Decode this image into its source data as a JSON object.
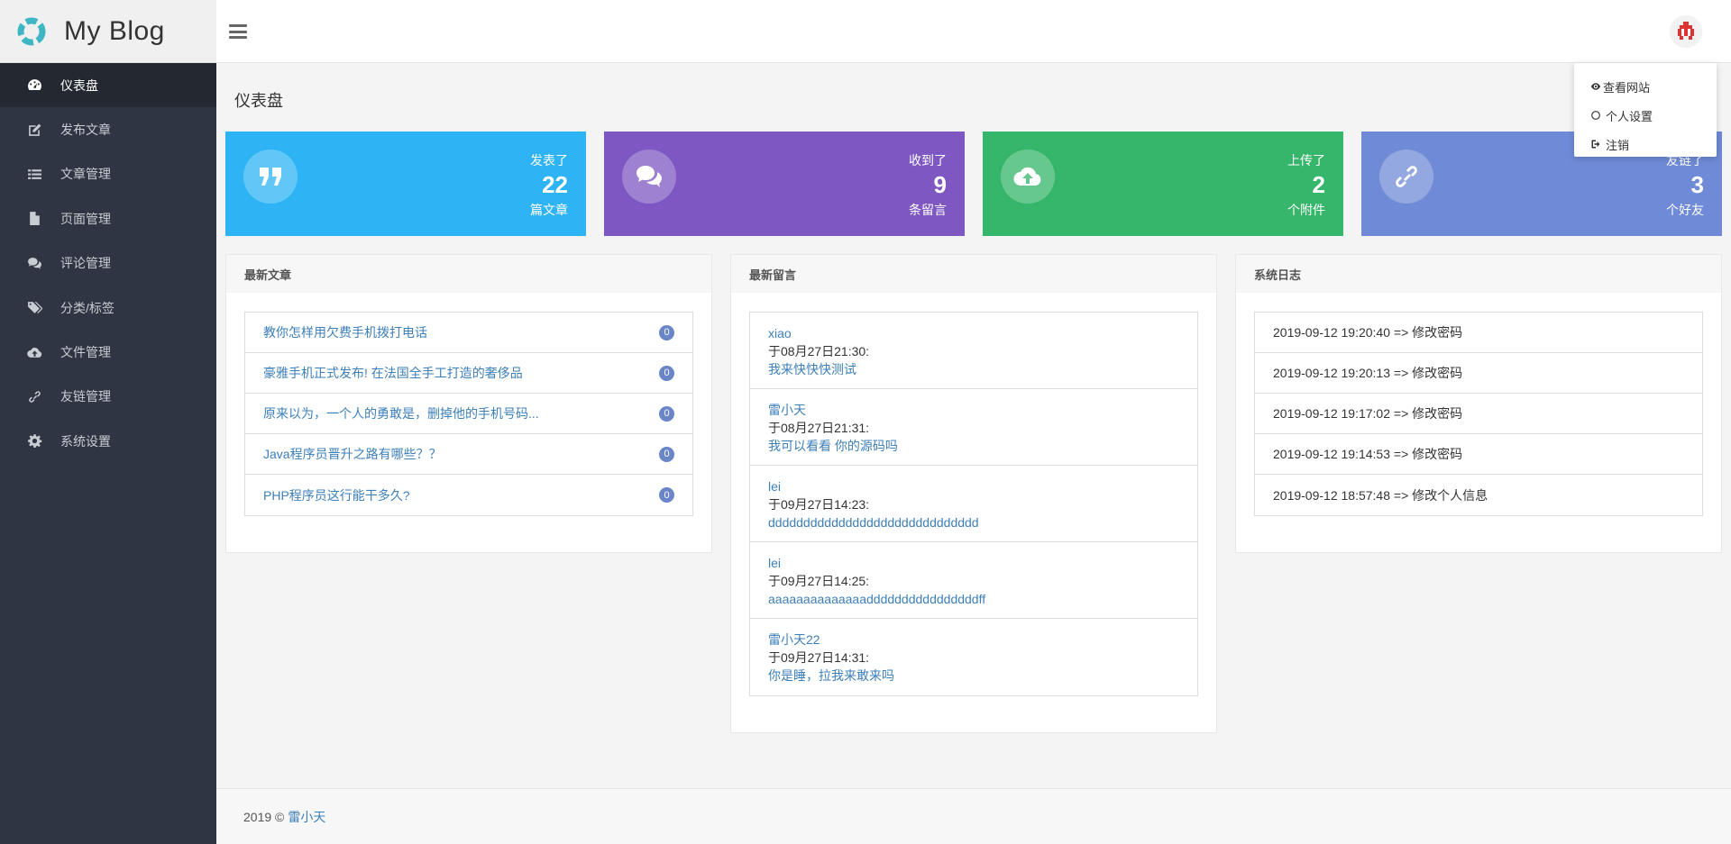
{
  "brand": {
    "title": "My Blog"
  },
  "sidebar": {
    "items": [
      {
        "label": "仪表盘",
        "icon": "dashboard-icon"
      },
      {
        "label": "发布文章",
        "icon": "edit-icon"
      },
      {
        "label": "文章管理",
        "icon": "list-icon"
      },
      {
        "label": "页面管理",
        "icon": "file-icon"
      },
      {
        "label": "评论管理",
        "icon": "comments-icon"
      },
      {
        "label": "分类/标签",
        "icon": "tags-icon"
      },
      {
        "label": "文件管理",
        "icon": "cloud-upload-icon"
      },
      {
        "label": "友链管理",
        "icon": "link-icon"
      },
      {
        "label": "系统设置",
        "icon": "gear-icon"
      }
    ]
  },
  "dropdown": {
    "items": [
      {
        "label": "查看网站",
        "icon": "eye-icon"
      },
      {
        "label": "个人设置",
        "icon": "settings-icon"
      },
      {
        "label": "注销",
        "icon": "sign-out-icon"
      }
    ]
  },
  "main": {
    "title": "仪表盘",
    "stats": [
      {
        "top": "发表了",
        "value": "22",
        "bottom": "篇文章",
        "color": "#2eb3f5",
        "icon": "quote-icon"
      },
      {
        "top": "收到了",
        "value": "9",
        "bottom": "条留言",
        "color": "#7e57c2",
        "icon": "comments-icon"
      },
      {
        "top": "上传了",
        "value": "2",
        "bottom": "个附件",
        "color": "#35b66a",
        "icon": "cloud-upload-icon"
      },
      {
        "top": "友链了",
        "value": "3",
        "bottom": "个好友",
        "color": "#6f8bd7",
        "icon": "link-icon"
      }
    ],
    "articles": {
      "title": "最新文章",
      "items": [
        {
          "title": "教你怎样用欠费手机拨打电话",
          "count": "0"
        },
        {
          "title": "豪雅手机正式发布! 在法国全手工打造的奢侈品",
          "count": "0"
        },
        {
          "title": "原来以为，一个人的勇敢是，删掉他的手机号码...",
          "count": "0"
        },
        {
          "title": "Java程序员晋升之路有哪些？？",
          "count": "0"
        },
        {
          "title": "PHP程序员这行能干多久?",
          "count": "0"
        }
      ]
    },
    "comments": {
      "title": "最新留言",
      "items": [
        {
          "author": "xiao",
          "time": "于08月27日21:30:",
          "content": "我来快快快测试"
        },
        {
          "author": "雷小天",
          "time": "于08月27日21:31:",
          "content": "我可以看看 你的源码吗"
        },
        {
          "author": "lei",
          "time": "于09月27日14:23:",
          "content": "dddddddddddddddddddddddddddddd"
        },
        {
          "author": "lei",
          "time": "于09月27日14:25:",
          "content": "aaaaaaaaaaaaaaddddddddddddddddff"
        },
        {
          "author": "雷小天22",
          "time": "于09月27日14:31:",
          "content": "你是睡，拉我来敢来吗"
        }
      ]
    },
    "logs": {
      "title": "系统日志",
      "items": [
        "2019-09-12 19:20:40 => 修改密码",
        "2019-09-12 19:20:13 => 修改密码",
        "2019-09-12 19:17:02 => 修改密码",
        "2019-09-12 19:14:53 => 修改密码",
        "2019-09-12 18:57:48 => 修改个人信息"
      ]
    }
  },
  "footer": {
    "text": "2019 ©",
    "author": "雷小天"
  }
}
